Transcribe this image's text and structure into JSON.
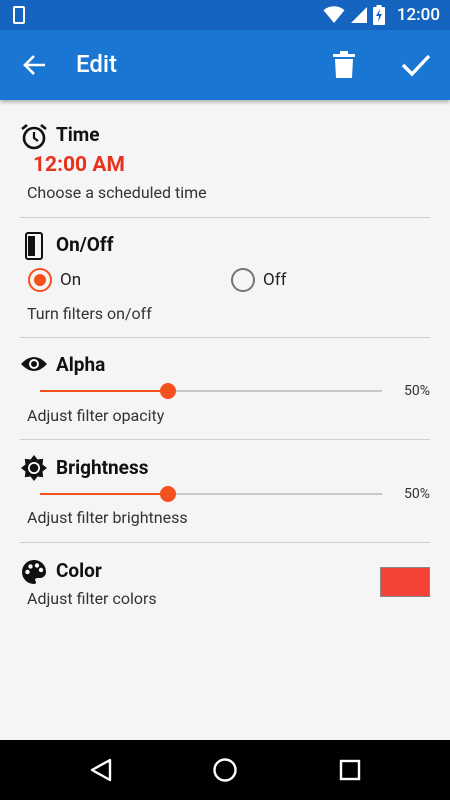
{
  "status_bar": {
    "time": "12:00"
  },
  "app_bar": {
    "title": "Edit"
  },
  "sections": {
    "time": {
      "title": "Time",
      "value": "12:00 AM",
      "description": "Choose a scheduled time"
    },
    "onoff": {
      "title": "On/Off",
      "options": [
        "On",
        "Off"
      ],
      "selected": "On",
      "description": "Turn filters on/off"
    },
    "alpha": {
      "title": "Alpha",
      "value_label": "50%",
      "value": 0.375,
      "description": "Adjust filter opacity"
    },
    "brightness": {
      "title": "Brightness",
      "value_label": "50%",
      "value": 0.375,
      "description": "Adjust filter brightness"
    },
    "color": {
      "title": "Color",
      "description": "Adjust filter colors",
      "swatch_color": "#f44336"
    }
  },
  "colors": {
    "status_bar": "#1565c0",
    "app_bar": "#1976d2",
    "accent": "#f4511e",
    "time_text": "#e8321e"
  }
}
